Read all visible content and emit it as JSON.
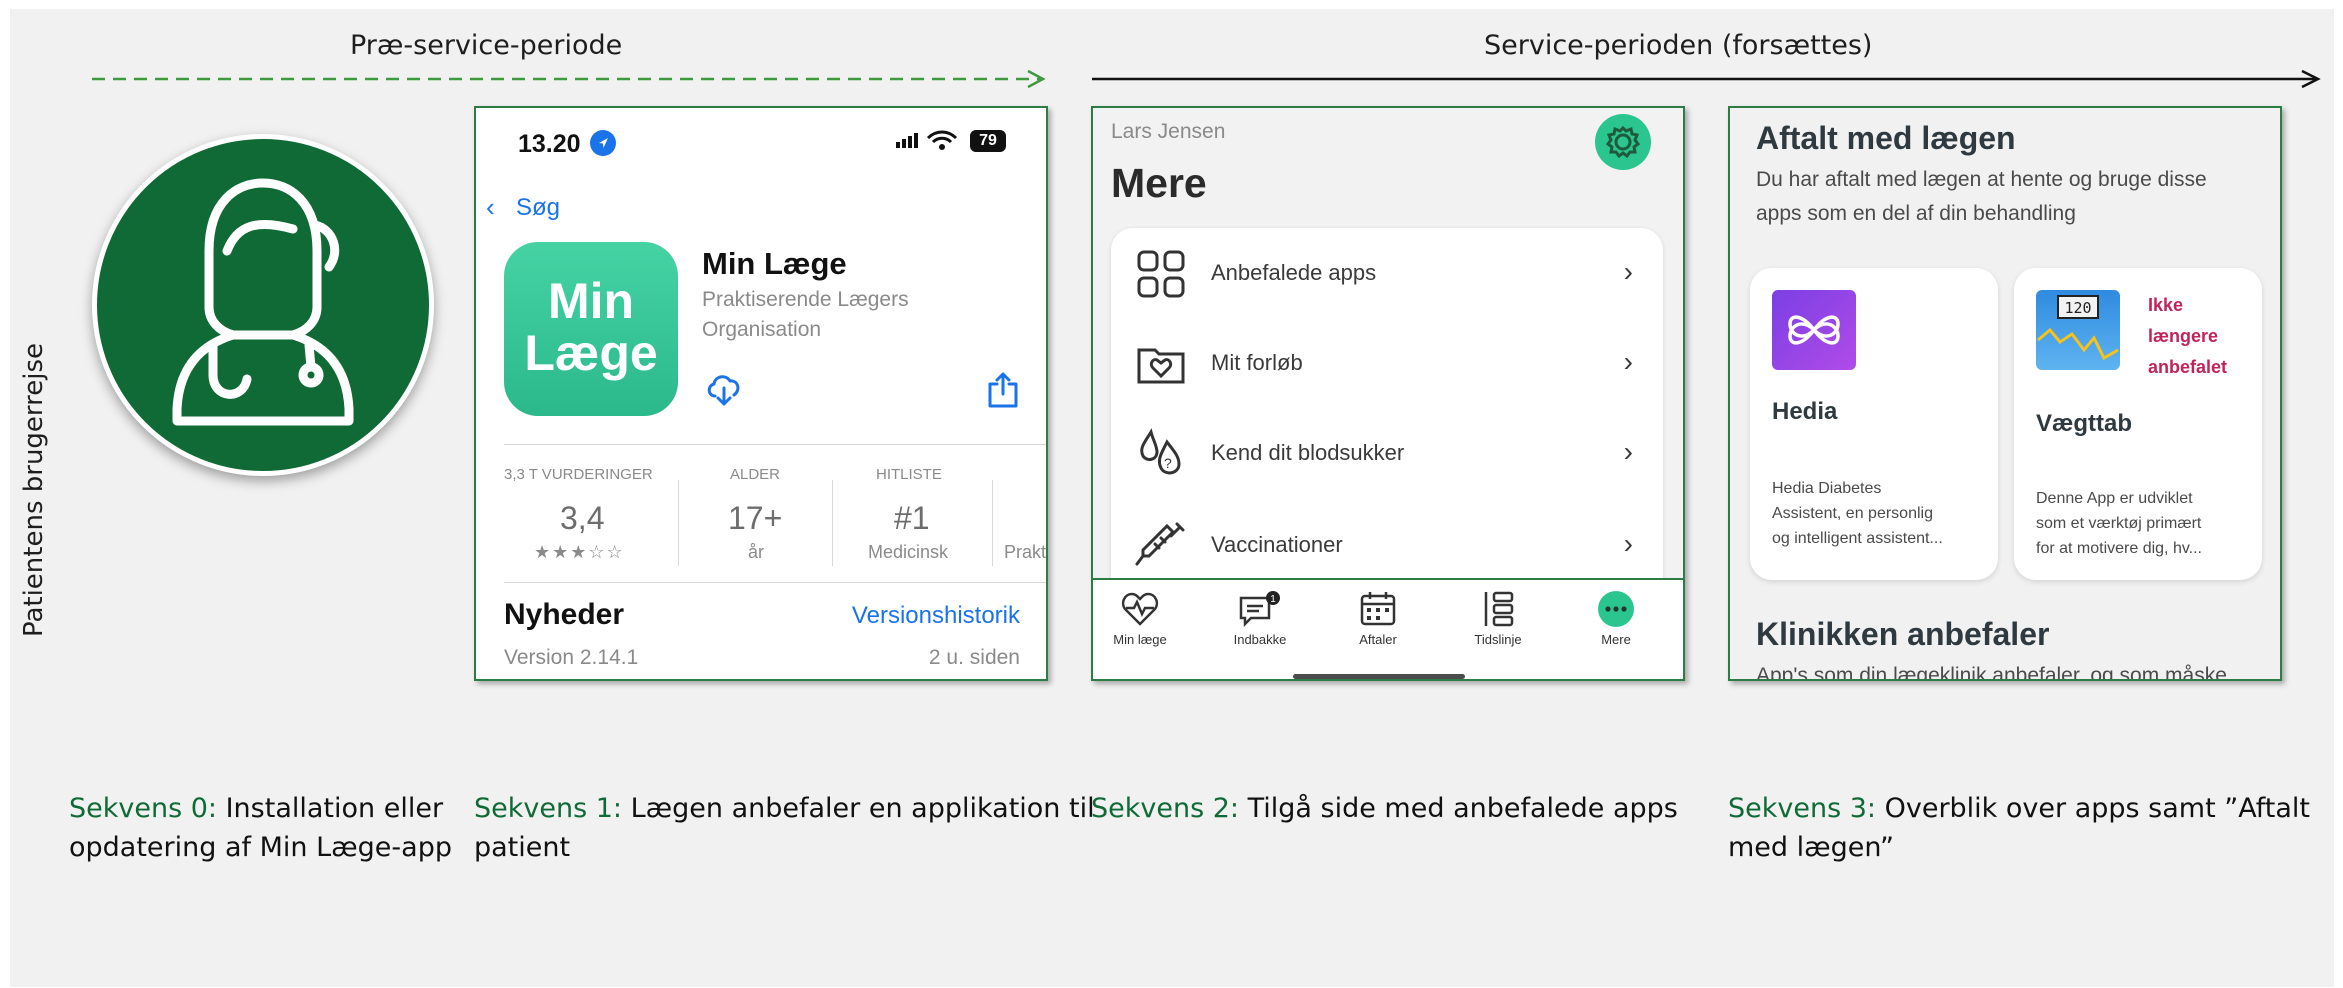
{
  "phases": {
    "pre": "Præ-service-periode",
    "service": "Service-perioden (forsættes)"
  },
  "side_label": "Patientens brugerrejse",
  "colors": {
    "brand_green": "#0f6a36",
    "frame_green": "#2c7c46",
    "accent_mint": "#2bc68f",
    "ios_blue": "#1a73e8",
    "warning_red": "#c0245a"
  },
  "icons": {
    "doctor": "doctor-avatar-icon"
  },
  "screen1": {
    "time": "13.20",
    "battery": "79",
    "back": "Søg",
    "app_icon_line1": "Min",
    "app_icon_line2": "Læge",
    "app_name": "Min Læge",
    "developer_line1": "Praktiserende Lægers",
    "developer_line2": "Organisation",
    "stats": [
      {
        "header": "3,3 T VURDERINGER",
        "value": "3,4",
        "sub": "★★★☆☆"
      },
      {
        "header": "ALDER",
        "value": "17+",
        "sub": "år"
      },
      {
        "header": "HITLISTE",
        "value": "#1",
        "sub": "Medicinsk"
      },
      {
        "header": "",
        "value": "",
        "sub": "Prakt"
      }
    ],
    "news_title": "Nyheder",
    "version_history": "Versionshistorik",
    "version": "Version 2.14.1",
    "updated": "2 u. siden"
  },
  "screen2": {
    "user": "Lars Jensen",
    "title": "Mere",
    "items": [
      {
        "label": "Anbefalede apps",
        "icon": "apps-grid-icon"
      },
      {
        "label": "Mit forløb",
        "icon": "heart-folder-icon"
      },
      {
        "label": "Kend dit blodsukker",
        "icon": "blood-drops-icon"
      },
      {
        "label": "Vaccinationer",
        "icon": "syringe-icon"
      }
    ],
    "chevron": "›",
    "tabs": [
      {
        "label": "Min læge",
        "icon": "heart-pulse-icon"
      },
      {
        "label": "Indbakke",
        "icon": "chat-icon",
        "badge": "1"
      },
      {
        "label": "Aftaler",
        "icon": "calendar-icon"
      },
      {
        "label": "Tidslinje",
        "icon": "timeline-icon"
      },
      {
        "label": "Mere",
        "icon": "more-icon"
      }
    ]
  },
  "screen3": {
    "heading": "Aftalt med lægen",
    "intro_line1": "Du har aftalt med lægen at hente og bruge disse",
    "intro_line2": "apps som en del af din behandling",
    "apps": [
      {
        "name": "Hedia",
        "desc_lines": [
          "Hedia Diabetes",
          "Assistent, en personlig",
          "og intelligent assistent..."
        ]
      },
      {
        "name": "Vægttab",
        "badge_lines": [
          "Ikke",
          "længere",
          "anbefalet"
        ],
        "icon_text": "120",
        "desc_lines": [
          "Denne App er udviklet",
          "som et værktøj primært",
          "for at motivere dig, hv..."
        ]
      }
    ],
    "clinic_heading": "Klinikken anbefaler",
    "clinic_intro": "App's som din lægeklinik anbefaler, og som måske"
  },
  "captions": [
    {
      "seq": "Sekvens 0:",
      "line1": " Installation eller",
      "line2": "opdatering af Min Læge-app"
    },
    {
      "seq": "Sekvens 1:",
      "line1": " Lægen anbefaler en applikation til",
      "line2": "patient"
    },
    {
      "seq": "Sekvens 2:",
      "line1": " Tilgå side med anbefalede apps",
      "line2": ""
    },
    {
      "seq": "Sekvens 3:",
      "line1": " Overblik over apps samt ”Aftalt",
      "line2": "med lægen”"
    }
  ]
}
